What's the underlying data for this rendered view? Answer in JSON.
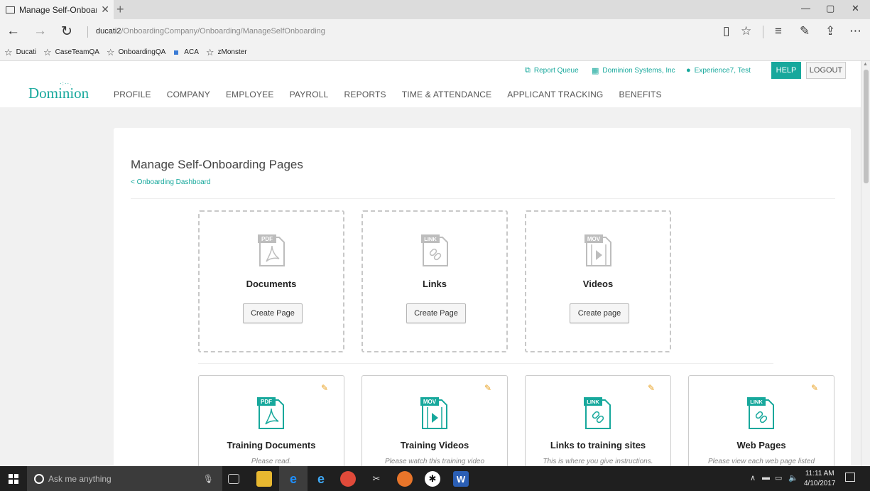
{
  "browser": {
    "tab_title": "Manage Self-Onboardir",
    "tab_close": "✕",
    "new_tab": "+",
    "url_host": "ducati2",
    "url_path": "/OnboardingCompany/Onboarding/ManageSelfOnboarding",
    "window_controls": [
      "—",
      "▢",
      "✕"
    ],
    "favorites": [
      {
        "label": "Ducati",
        "icon": "star-icon"
      },
      {
        "label": "CaseTeamQA",
        "icon": "star-icon"
      },
      {
        "label": "OnboardingQA",
        "icon": "star-icon"
      },
      {
        "label": "ACA",
        "icon": "app-square-icon"
      },
      {
        "label": "zMonster",
        "icon": "star-icon"
      }
    ]
  },
  "header": {
    "logo": "Dominion",
    "nav": [
      "PROFILE",
      "COMPANY",
      "EMPLOYEE",
      "PAYROLL",
      "REPORTS",
      "TIME & ATTENDANCE",
      "APPLICANT TRACKING",
      "BENEFITS"
    ],
    "report_queue": "Report Queue",
    "company": "Dominion Systems, Inc",
    "user": "Experience7, Test",
    "help": "HELP",
    "logout": "LOGOUT"
  },
  "main": {
    "title": "Manage Self-Onboarding Pages",
    "back_link": "< Onboarding Dashboard",
    "templates": [
      {
        "title": "Documents",
        "badge": "PDF",
        "button": "Create Page"
      },
      {
        "title": "Links",
        "badge": "LINK",
        "button": "Create Page"
      },
      {
        "title": "Videos",
        "badge": "MOV",
        "button": "Create page"
      }
    ],
    "pages": [
      {
        "title": "Training Documents",
        "badge": "PDF",
        "desc": "Please read."
      },
      {
        "title": "Training Videos",
        "badge": "MOV",
        "desc": "Please watch this training video"
      },
      {
        "title": "Links to training sites",
        "badge": "LINK",
        "desc": "This is where you give instructions."
      },
      {
        "title": "Web Pages",
        "badge": "LINK",
        "desc": "Please view each web page listed"
      }
    ]
  },
  "taskbar": {
    "search_placeholder": "Ask me anything",
    "time": "11:11 AM",
    "date": "4/10/2017"
  },
  "colors": {
    "accent": "#17a89c",
    "template_icon": "#bdbdbd",
    "edit_icon": "#e8a020"
  }
}
